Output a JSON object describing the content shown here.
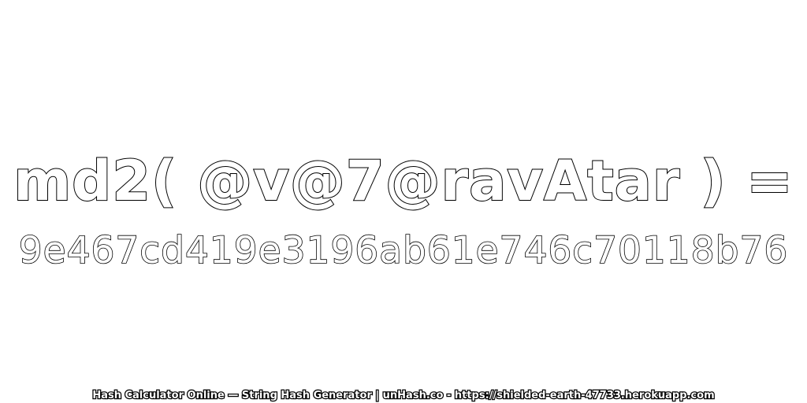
{
  "expression": "md2( @v@7@ravAtar ) =",
  "hash_value": "9e467cd419e3196ab61e746c70118b76",
  "footer": "Hash Calculator Online — String Hash Generator | unHash.co - https://shielded-earth-47733.herokuapp.com",
  "colors": {
    "background": "#ffffff",
    "text_fill": "#ffffff",
    "text_outline": "#000000"
  }
}
